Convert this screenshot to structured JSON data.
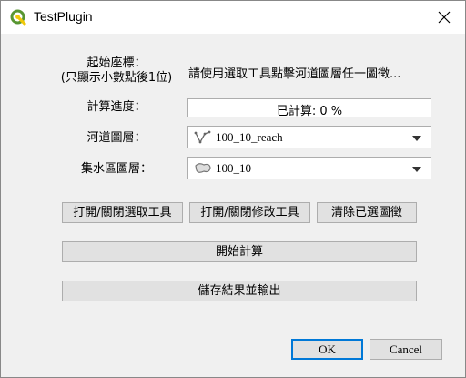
{
  "window": {
    "title": "TestPlugin"
  },
  "form": {
    "start_coord_label": "起始座標：\n(只顯示小數點後1位)",
    "start_coord_value": "請使用選取工具點擊河道圖層任一圖徵...",
    "progress_label": "計算進度：",
    "progress_text": "已計算: 0 %",
    "progress_fraction": 0,
    "reach_layer_label": "河道圖層：",
    "reach_layer_value": "100_10_reach",
    "catchment_layer_label": "集水區圖層：",
    "catchment_layer_value": "100_10"
  },
  "buttons": {
    "toggle_select_tool": "打開/關閉選取工具",
    "toggle_edit_tool": "打開/關閉修改工具",
    "clear_selected": "清除已選圖徵",
    "start_calc": "開始計算",
    "save_export": "儲存結果並輸出",
    "ok": "OK",
    "cancel": "Cancel"
  },
  "colors": {
    "progress_fill": "#06b025",
    "qgis_green": "#589632",
    "qgis_yellow": "#f0c808",
    "default_border": "#0078d7"
  }
}
